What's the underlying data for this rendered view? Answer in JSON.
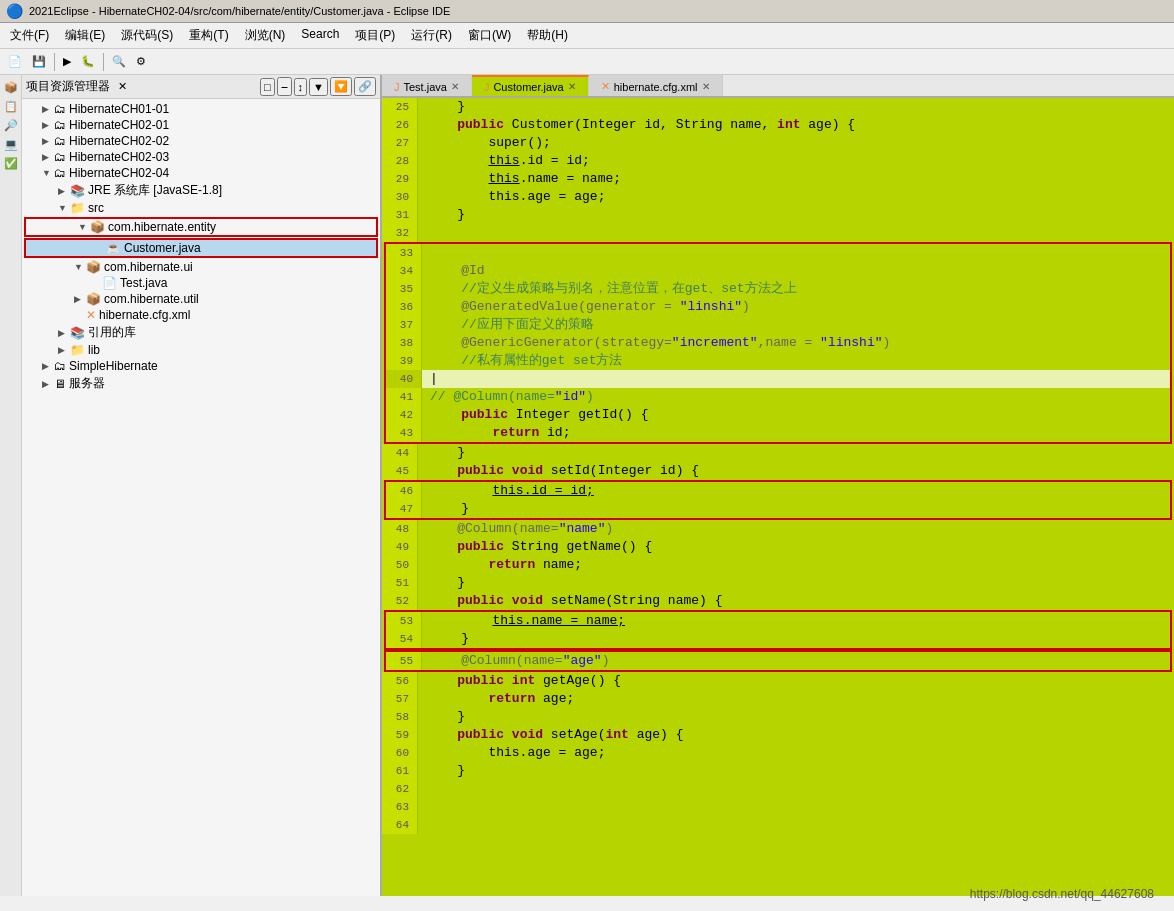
{
  "titleBar": {
    "title": "2021Eclipse - HibernateCH02-04/src/com/hibernate/entity/Customer.java - Eclipse IDE"
  },
  "menuBar": {
    "items": [
      "文件(F)",
      "编辑(E)",
      "源代码(S)",
      "重构(T)",
      "浏览(N)",
      "Search",
      "项目(P)",
      "运行(R)",
      "窗口(W)",
      "帮助(H)"
    ]
  },
  "explorer": {
    "title": "项目资源管理器",
    "headerButtons": [
      "□",
      "‒",
      "×",
      "↕",
      "▼",
      "≡"
    ],
    "trees": [
      {
        "label": "HibernateCH01-01",
        "level": 1,
        "icon": "📁",
        "expanded": false
      },
      {
        "label": "HibernateCH02-01",
        "level": 1,
        "icon": "📁",
        "expanded": false
      },
      {
        "label": "HibernateCH02-02",
        "level": 1,
        "icon": "📁",
        "expanded": false
      },
      {
        "label": "HibernateCH02-03",
        "level": 1,
        "icon": "📁",
        "expanded": false
      },
      {
        "label": "HibernateCH02-04",
        "level": 1,
        "icon": "📁",
        "expanded": true
      },
      {
        "label": "JRE 系统库 [JavaSE-1.8]",
        "level": 2,
        "icon": "📚",
        "expanded": false
      },
      {
        "label": "src",
        "level": 2,
        "icon": "📁",
        "expanded": true
      },
      {
        "label": "com.hibernate.entity",
        "level": 3,
        "icon": "📦",
        "expanded": true,
        "highlighted": true
      },
      {
        "label": "Customer.java",
        "level": 4,
        "icon": "☕",
        "highlighted": true
      },
      {
        "label": "com.hibernate.ui",
        "level": 3,
        "icon": "📦",
        "expanded": true
      },
      {
        "label": "Test.java",
        "level": 4,
        "icon": "📄"
      },
      {
        "label": "com.hibernate.util",
        "level": 3,
        "icon": "📦",
        "expanded": false
      },
      {
        "label": "hibernate.cfg.xml",
        "level": 3,
        "icon": "🔧"
      },
      {
        "label": "引用的库",
        "level": 2,
        "icon": "📚",
        "expanded": false
      },
      {
        "label": "lib",
        "level": 2,
        "icon": "📁",
        "expanded": false
      },
      {
        "label": "SimpleHibernate",
        "level": 1,
        "icon": "📁",
        "expanded": false
      },
      {
        "label": "服务器",
        "level": 1,
        "icon": "🖥️",
        "expanded": false
      }
    ]
  },
  "tabs": [
    {
      "label": "Test.java",
      "icon": "J",
      "active": false,
      "closable": true
    },
    {
      "label": "Customer.java",
      "icon": "J",
      "active": true,
      "closable": true
    },
    {
      "label": "hibernate.cfg.xml",
      "icon": "X",
      "active": false,
      "closable": true
    }
  ],
  "codeLines": [
    {
      "num": 25,
      "content": "    }"
    },
    {
      "num": 26,
      "content": "    public Customer(Integer id, String name, int age) {",
      "hasBold": true
    },
    {
      "num": 27,
      "content": "        super();"
    },
    {
      "num": 28,
      "content": "        this.id = id;"
    },
    {
      "num": 29,
      "content": "        this.name = name;"
    },
    {
      "num": 30,
      "content": "        this.age = age;"
    },
    {
      "num": 31,
      "content": "    }"
    },
    {
      "num": 32,
      "content": ""
    },
    {
      "num": 33,
      "content": ""
    },
    {
      "num": 34,
      "content": "    @Id",
      "annotation": true
    },
    {
      "num": 35,
      "content": "    //定义生成策略与别名，注意位置，在get、set方法之上",
      "comment": true
    },
    {
      "num": 36,
      "content": "    @GeneratedValue(generator = \"linshi\")",
      "annotation": true
    },
    {
      "num": 37,
      "content": "    //应用下面定义的策略",
      "comment": true
    },
    {
      "num": 38,
      "content": "    @GenericGenerator(strategy=\"increment\",name = \"linshi\")",
      "annotation": true
    },
    {
      "num": 39,
      "content": "    //私有属性的get set方法",
      "comment": true
    },
    {
      "num": 40,
      "content": ""
    },
    {
      "num": 41,
      "content": "// @Column(name=\"id\")",
      "comment": true
    },
    {
      "num": 42,
      "content": "    public Integer getId() {",
      "hasBold": true
    },
    {
      "num": 43,
      "content": "        return id;"
    },
    {
      "num": 44,
      "content": "    }"
    },
    {
      "num": 45,
      "content": "    public void setId(Integer id) {",
      "hasBold": true
    },
    {
      "num": 46,
      "content": "        this.id = id;",
      "underline": true
    },
    {
      "num": 47,
      "content": "    }"
    },
    {
      "num": 48,
      "content": "    @Column(name=\"name\")",
      "annotation": true
    },
    {
      "num": 49,
      "content": "    public String getName() {",
      "hasBold": true
    },
    {
      "num": 50,
      "content": "        return name;"
    },
    {
      "num": 51,
      "content": "    }"
    },
    {
      "num": 52,
      "content": "    public void setName(String name) {",
      "hasBold": true
    },
    {
      "num": 53,
      "content": "        this.name = name;",
      "underline": true
    },
    {
      "num": 54,
      "content": "    }"
    },
    {
      "num": 55,
      "content": "    @Column(name=\"age\")",
      "annotation": true,
      "redBox": true
    },
    {
      "num": 56,
      "content": "    public int getAge() {",
      "hasBold": true
    },
    {
      "num": 57,
      "content": "        return age;"
    },
    {
      "num": 58,
      "content": "    }"
    },
    {
      "num": 59,
      "content": "    public void setAge(int age) {",
      "hasBold": true
    },
    {
      "num": 60,
      "content": "        this.age = age;"
    },
    {
      "num": 61,
      "content": "    }"
    },
    {
      "num": 62,
      "content": ""
    },
    {
      "num": 63,
      "content": ""
    },
    {
      "num": 64,
      "content": ""
    }
  ],
  "watermark": "https://blog.csdn.net/qq_44627608"
}
